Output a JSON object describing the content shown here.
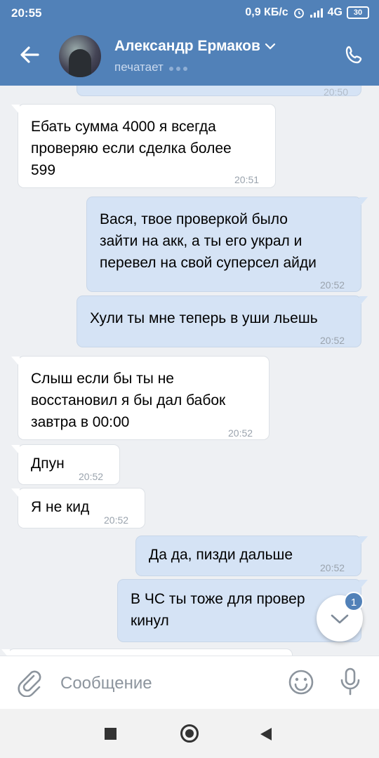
{
  "status_bar": {
    "time": "20:55",
    "network_speed": "0,9 КБ/с",
    "network_type": "4G",
    "battery": "30"
  },
  "header": {
    "contact_name": "Александр Ермаков",
    "status": "печатает",
    "accent_color": "#5181b8"
  },
  "messages": [
    {
      "direction": "out",
      "text": "",
      "time": "20:50"
    },
    {
      "direction": "in",
      "text": "Ебать сумма 4000 я всегда\nпроверяю если сделка более\n599",
      "time": "20:51"
    },
    {
      "direction": "out",
      "text": "Вася, твое проверкой было\nзайти на акк, а ты его украл и\nперевел на свой суперсел айди",
      "time": "20:52"
    },
    {
      "direction": "out",
      "text": "Хули ты мне теперь в уши льешь",
      "time": "20:52"
    },
    {
      "direction": "in",
      "text": "Слыш если бы ты не\nвосстановил я бы дал бабок\nзавтра в 00:00",
      "time": "20:52"
    },
    {
      "direction": "in",
      "text": "Дпун",
      "time": "20:52"
    },
    {
      "direction": "in",
      "text": "Я не кид",
      "time": "20:52"
    },
    {
      "direction": "out",
      "text": "Да да, пизди дальше",
      "time": "20:52"
    },
    {
      "direction": "out",
      "text": "В ЧС ты тоже для провер\nкинул",
      "time": ""
    },
    {
      "direction": "in",
      "text": "",
      "time": ""
    }
  ],
  "scroll_down": {
    "unread_count": "1"
  },
  "composer": {
    "placeholder": "Сообщение"
  },
  "icons": {
    "back": "arrow-left-icon",
    "call": "phone-icon",
    "attach": "paperclip-icon",
    "emoji": "smiley-icon",
    "mic": "microphone-icon",
    "dropdown": "chevron-down-icon"
  }
}
